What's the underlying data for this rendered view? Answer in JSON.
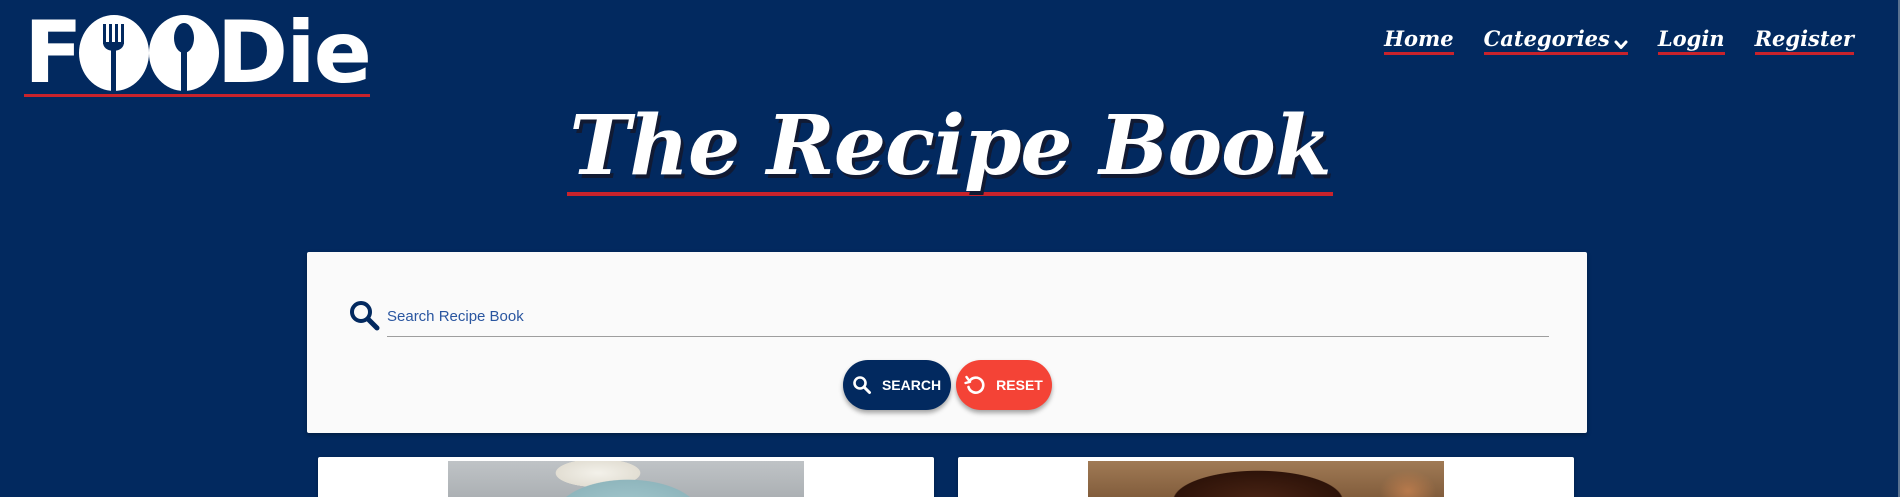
{
  "brand": {
    "logo_text_start": "F",
    "logo_text_end": "Die",
    "logo_icons": [
      "fork-icon",
      "spoon-icon"
    ]
  },
  "nav": {
    "items": [
      {
        "label": "Home"
      },
      {
        "label": "Categories",
        "has_dropdown": true
      },
      {
        "label": "Login"
      },
      {
        "label": "Register"
      }
    ]
  },
  "page": {
    "title": "The Recipe Book"
  },
  "search": {
    "placeholder": "Search Recipe Book",
    "value": "",
    "search_button_label": "SEARCH",
    "reset_button_label": "RESET"
  },
  "colors": {
    "background": "#02295f",
    "accent_red": "#c8232c",
    "reset_button": "#f44336",
    "card": "#fafafa"
  },
  "recipes": [
    {
      "image": "recipe-image-1"
    },
    {
      "image": "recipe-image-2"
    }
  ]
}
